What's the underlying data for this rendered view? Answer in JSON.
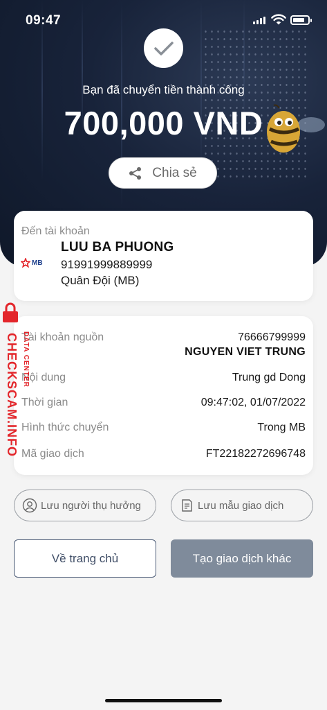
{
  "status_bar": {
    "time": "09:47"
  },
  "result": {
    "message": "Bạn đã chuyển tiền thành công",
    "amount": "700,000 VND",
    "share_label": "Chia sẻ"
  },
  "recipient": {
    "to_label": "Đến tài khoản",
    "bank_logo_text": "MB",
    "name": "LUU BA PHUONG",
    "account": "91991999889999",
    "bank": "Quân Đội (MB)"
  },
  "details": {
    "source_label": "Tài khoản nguồn",
    "source_account": "76666799999",
    "source_name": "NGUYEN VIET TRUNG",
    "content_label": "Nội dung",
    "content_value": "Trung gd Dong",
    "time_label": "Thời gian",
    "time_value": "09:47:02, 01/07/2022",
    "method_label": "Hình thức chuyển",
    "method_value": "Trong MB",
    "txn_label": "Mã giao dịch",
    "txn_value": "FT22182272696748"
  },
  "actions": {
    "save_beneficiary": "Lưu người thụ hưởng",
    "save_template": "Lưu mẫu giao dịch",
    "home": "Về trang chủ",
    "new_transaction": "Tạo giao dịch khác"
  },
  "watermark": {
    "main": "CHECKSCAM.INFO",
    "sub": "DATA CENTER"
  },
  "colors": {
    "hero_bg": "#0f1829",
    "primary_button": "#7f8b9b",
    "watermark_red": "#e3262b"
  }
}
